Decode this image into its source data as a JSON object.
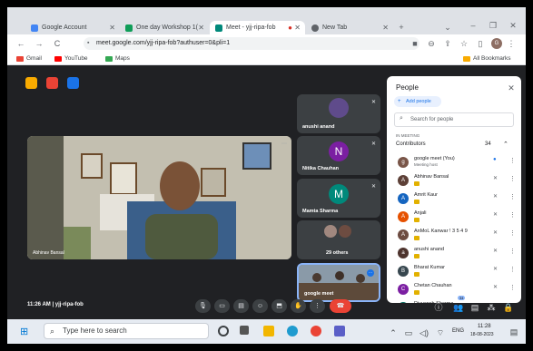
{
  "browser": {
    "tabs": [
      {
        "title": "Google Account",
        "color": "#4285f4"
      },
      {
        "title": "One day Workshop 1(",
        "color": "#0f9d58"
      },
      {
        "title": "Meet - yjj-ripa-fob",
        "color": "#00897b"
      },
      {
        "title": "New Tab",
        "color": "#5f6368"
      }
    ],
    "url": "meet.google.com/yjj-ripa-fob?authuser=0&pli=1",
    "bookmarks": [
      {
        "label": "Gmail",
        "color": "#ea4335"
      },
      {
        "label": "YouTube",
        "color": "#ff0000"
      },
      {
        "label": "Maps",
        "color": "#34a853"
      }
    ],
    "all_bookmarks": "All Bookmarks"
  },
  "meet": {
    "meeting_info": "11:26 AM  |  yjj-ripa-fob",
    "main_speaker_name": "Abhinav Bansal",
    "tiles": [
      {
        "name": "anushi anand",
        "initial": "",
        "color": "#5f4b8b"
      },
      {
        "name": "Nitika Chauhan",
        "initial": "N",
        "color": "#7b1fa2"
      },
      {
        "name": "Mamta Sharma",
        "initial": "M",
        "color": "#00897b"
      },
      {
        "name": "29 others",
        "initial": "",
        "color": "#3c4043"
      },
      {
        "name": "google meet",
        "initial": "",
        "color": "#6d7b8d"
      }
    ],
    "badge_count": "34"
  },
  "people_panel": {
    "title": "People",
    "add_people": "Add people",
    "search_placeholder": "Search for people",
    "section_label": "IN MEETING",
    "contributors_label": "Contributors",
    "contributors_count": "34",
    "participants": [
      {
        "name": "google meet (You)",
        "sub": "Meeting host",
        "initial": "g",
        "color": "#795548"
      },
      {
        "name": "Abhinav Bansal",
        "sub": "",
        "initial": "A",
        "color": "#5d4037"
      },
      {
        "name": "Amrit Kaur",
        "sub": "",
        "initial": "A",
        "color": "#1565c0"
      },
      {
        "name": "Anjali",
        "sub": "",
        "initial": "A",
        "color": "#e65100"
      },
      {
        "name": "AnMoL Kanwar ! 3 5 4 9",
        "sub": "",
        "initial": "A",
        "color": "#6d4c41"
      },
      {
        "name": "anushi anand",
        "sub": "",
        "initial": "a",
        "color": "#4e342e"
      },
      {
        "name": "Bharat Kumar",
        "sub": "",
        "initial": "B",
        "color": "#37474f"
      },
      {
        "name": "Chetan Chauhan",
        "sub": "",
        "initial": "C",
        "color": "#7b1fa2"
      },
      {
        "name": "Divyansh Sharma",
        "sub": "",
        "initial": "D",
        "color": "#00695c"
      }
    ]
  },
  "taskbar": {
    "search_placeholder": "Type here to search",
    "time": "11:28",
    "date": "18-08-2023",
    "lang": "ENG"
  }
}
